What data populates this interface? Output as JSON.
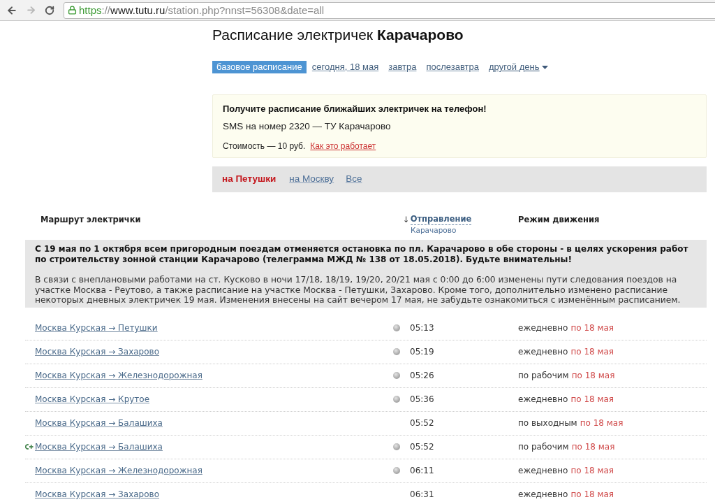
{
  "browser": {
    "secure": true,
    "url": {
      "scheme": "https",
      "separator": "://",
      "host": "www.tutu.ru",
      "path": "/station.php?nnst=56308&date=all"
    }
  },
  "title": "Расписание электричек **Карачарово**",
  "date_tabs": [
    {
      "label": "базовое расписание",
      "selected": true,
      "kind": "link"
    },
    {
      "label": "сегодня, 18 мая",
      "selected": false,
      "kind": "link"
    },
    {
      "label": "завтра",
      "selected": false,
      "kind": "link"
    },
    {
      "label": "послезавтра",
      "selected": false,
      "kind": "link"
    },
    {
      "label": "другой день",
      "selected": false,
      "kind": "dropdown"
    }
  ],
  "sms_promo": {
    "heading": "Получите расписание ближайших электричек на телефон!",
    "instruction": "SMS на номер 2320 — ТУ Карачарово",
    "cost": "Стоимость — 10 руб.",
    "link": "Как это работает"
  },
  "direction_tabs": [
    {
      "label": "на Петушки",
      "selected": true
    },
    {
      "label": "на Москву",
      "selected": false
    },
    {
      "label": "Все",
      "selected": false
    }
  ],
  "table": {
    "columns": [
      {
        "label": "Маршрут электрички"
      },
      {
        "label": "Отправление",
        "sort_arrow": "↓",
        "sublabel": "Карачарово"
      },
      {
        "label": "Режим движения"
      }
    ],
    "notice": {
      "headline": "С 19 мая по 1 октября всем пригородным поездам отменяется остановка по пл. Карачарово в обе стороны - в целях ускорения работ по строительству зонной станции Карачарово (телеграмма МЖД № 138 от 18.05.2018). Будьте внимательны!",
      "body": "В связи с внеплановыми работами на ст. Кусково в ночи 17/18, 18/19, 19/20, 20/21 мая с 0:00 до 6:00 изменены пути следования поездов на участке Москва - Реутово, а также расписание на участке Москва - Петушки, Захарово. Кроме того, дополнительно изменено расписание некоторых дневных электричек 19 мая. Изменения внесены на сайт вечером 17 мая, не забудьте ознакомиться с изменённым расписанием."
    },
    "rows": [
      {
        "route": "Москва Курская → Петушки",
        "added": false,
        "dot": true,
        "time": "05:13",
        "days": "ежедневно",
        "until": "по 18 мая"
      },
      {
        "route": "Москва Курская → Захарово",
        "added": false,
        "dot": true,
        "time": "05:19",
        "days": "ежедневно",
        "until": "по 18 мая"
      },
      {
        "route": "Москва Курская → Железнодорожная",
        "added": false,
        "dot": true,
        "time": "05:26",
        "days": "по рабочим",
        "until": "по 18 мая"
      },
      {
        "route": "Москва Курская → Крутое",
        "added": false,
        "dot": true,
        "time": "05:36",
        "days": "ежедневно",
        "until": "по 18 мая"
      },
      {
        "route": "Москва Курская → Балашиха",
        "added": false,
        "dot": false,
        "time": "05:52",
        "days": "по выходным",
        "until": "по 18 мая"
      },
      {
        "route": "Москва Курская → Балашиха",
        "added": true,
        "dot": true,
        "time": "05:52",
        "days": "по рабочим",
        "until": "по 18 мая"
      },
      {
        "route": "Москва Курская → Железнодорожная",
        "added": false,
        "dot": true,
        "time": "06:11",
        "days": "ежедневно",
        "until": "по 18 мая"
      },
      {
        "route": "Москва Курская → Захарово",
        "added": false,
        "dot": false,
        "time": "06:31",
        "days": "ежедневно",
        "until": "по 18 мая"
      }
    ]
  }
}
